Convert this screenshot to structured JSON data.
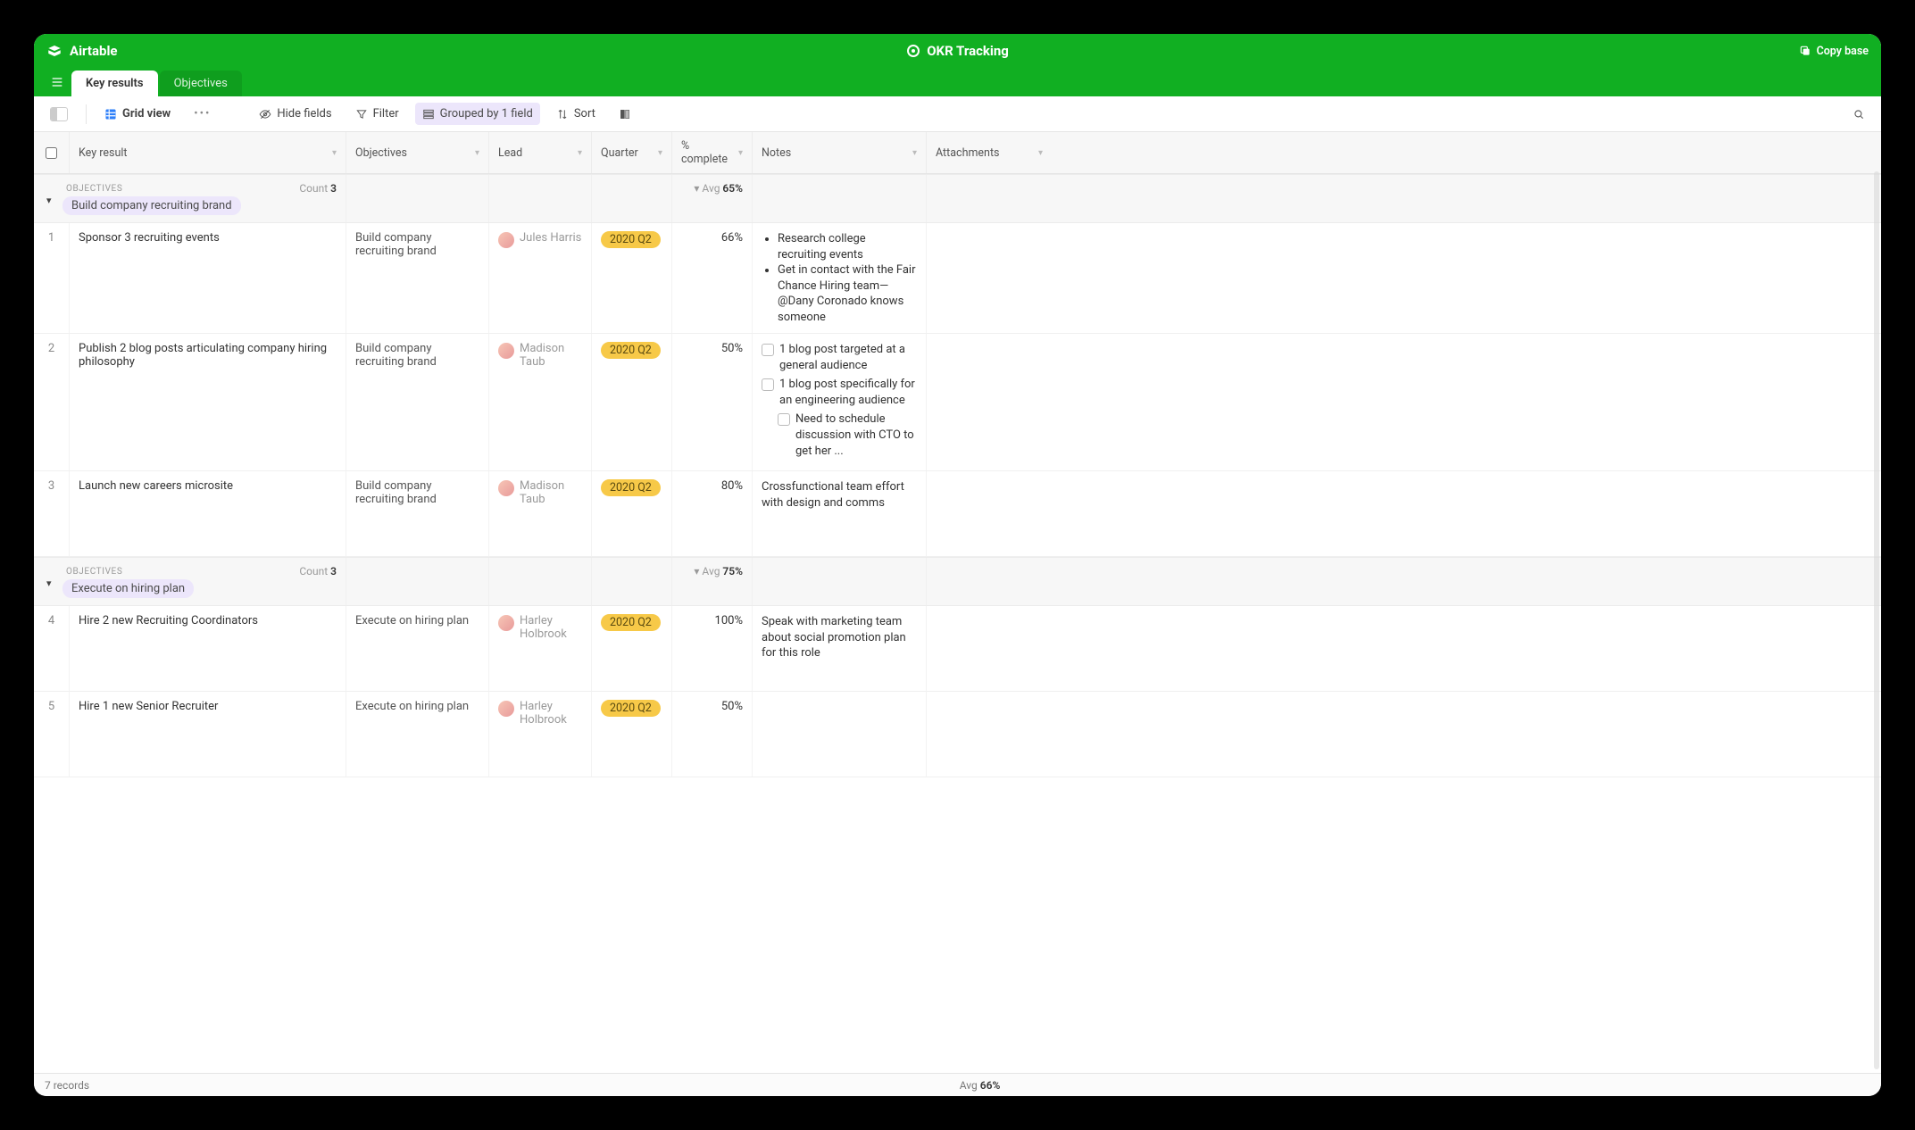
{
  "brand": "Airtable",
  "base_title": "OKR Tracking",
  "copy_base": "Copy base",
  "tabs": [
    {
      "label": "Key results",
      "active": true
    },
    {
      "label": "Objectives",
      "active": false
    }
  ],
  "toolbar": {
    "view_label": "Grid view",
    "hide_fields": "Hide fields",
    "filter": "Filter",
    "grouped_by": "Grouped by 1 field",
    "sort": "Sort"
  },
  "columns": {
    "c1": "Key result",
    "c2": "Objectives",
    "c3": "Lead",
    "c4": "Quarter",
    "c5": "% complete",
    "c6": "Notes",
    "c7": "Attachments"
  },
  "groups": [
    {
      "label_muted": "OBJECTIVES",
      "chip": "Build company recruiting brand",
      "count_label": "Count",
      "count": "3",
      "avg_label": "Avg",
      "avg": "65%",
      "rows": [
        {
          "idx": "1",
          "kr": "Sponsor 3 recruiting events",
          "obj": "Build company recruiting brand",
          "lead": "Jules Harris",
          "quarter": "2020 Q2",
          "pct": "66%",
          "notes_type": "bullets",
          "notes": [
            "Research college recruiting events",
            "Get in contact with the Fair Chance Hiring team—@Dany Coronado knows someone"
          ]
        },
        {
          "idx": "2",
          "kr": "Publish 2 blog posts articulating company hiring philosophy",
          "obj": "Build company recruiting brand",
          "lead": "Madison Taub",
          "quarter": "2020 Q2",
          "pct": "50%",
          "notes_type": "checks",
          "notes": [
            "1 blog post targeted at a general audience",
            "1 blog post specifically for an engineering audience"
          ],
          "notes_sub": "Need to schedule discussion with CTO to get her ..."
        },
        {
          "idx": "3",
          "kr": "Launch new careers microsite",
          "obj": "Build company recruiting brand",
          "lead": "Madison Taub",
          "quarter": "2020 Q2",
          "pct": "80%",
          "notes_type": "text",
          "notes_text": "Crossfunctional team effort with design and comms"
        }
      ]
    },
    {
      "label_muted": "OBJECTIVES",
      "chip": "Execute on hiring plan",
      "count_label": "Count",
      "count": "3",
      "avg_label": "Avg",
      "avg": "75%",
      "rows": [
        {
          "idx": "4",
          "kr": "Hire 2 new Recruiting Coordinators",
          "obj": "Execute on hiring plan",
          "lead": "Harley Holbrook",
          "quarter": "2020 Q2",
          "pct": "100%",
          "notes_type": "text",
          "notes_text": "Speak with marketing team about social promotion plan for this role"
        },
        {
          "idx": "5",
          "kr": "Hire 1 new Senior Recruiter",
          "obj": "Execute on hiring plan",
          "lead": "Harley Holbrook",
          "quarter": "2020 Q2",
          "pct": "50%",
          "notes_type": "none"
        }
      ]
    }
  ],
  "footer": {
    "records": "7 records",
    "avg_label": "Avg",
    "avg": "66%"
  }
}
